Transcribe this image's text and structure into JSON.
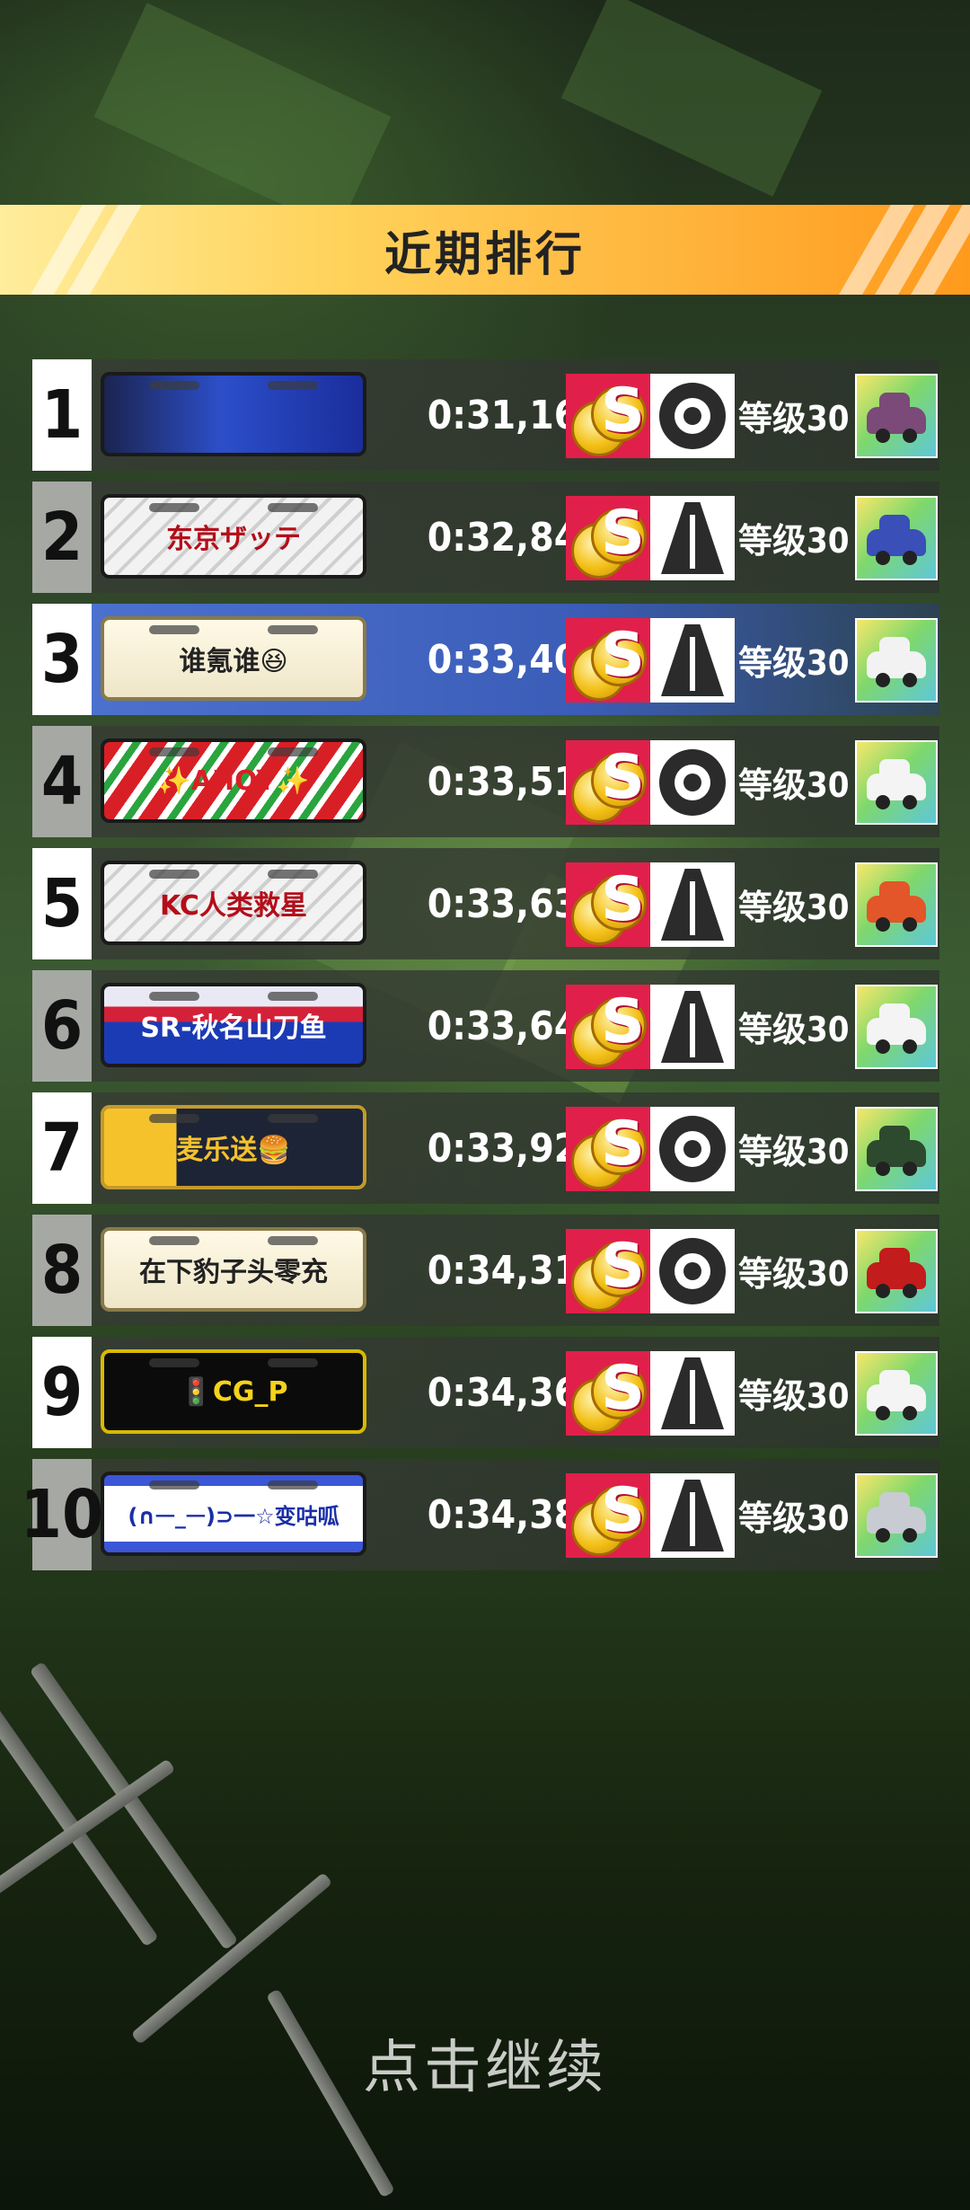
{
  "header": {
    "title": "近期排行"
  },
  "rows": [
    {
      "rank": "1",
      "plate": "",
      "plate_style": "blue-graphic",
      "time": "0:31,16",
      "tyre": "wheel",
      "level": "等级30",
      "car_color": "#7b4a78"
    },
    {
      "rank": "2",
      "plate": "东京ザッテ",
      "plate_style": "green-stripe",
      "time": "0:32,84",
      "tyre": "road",
      "level": "等级30",
      "car_color": "#3a4fb8"
    },
    {
      "rank": "3",
      "plate": "谁氪谁😆",
      "plate_style": "cream",
      "time": "0:33,40",
      "tyre": "road",
      "level": "等级30",
      "car_color": "#f2f2f2"
    },
    {
      "rank": "4",
      "plate": "✨AHOY✨",
      "plate_style": "red-green",
      "time": "0:33,51",
      "tyre": "wheel",
      "level": "等级30",
      "car_color": "#f4f4f4"
    },
    {
      "rank": "5",
      "plate": "KC人类救星",
      "plate_style": "green-stripe",
      "time": "0:33,63",
      "tyre": "road",
      "level": "等级30",
      "car_color": "#e2562a"
    },
    {
      "rank": "6",
      "plate": "SR-秋名山刀鱼",
      "plate_style": "flag-blue",
      "time": "0:33,64",
      "tyre": "road",
      "level": "等级30",
      "car_color": "#f4f4f4"
    },
    {
      "rank": "7",
      "plate": "麦乐送🍔",
      "plate_style": "gold-dark",
      "time": "0:33,92",
      "tyre": "wheel",
      "level": "等级30",
      "car_color": "#2e4a2e"
    },
    {
      "rank": "8",
      "plate": "在下豹子头零充",
      "plate_style": "cream",
      "time": "0:34,31",
      "tyre": "wheel",
      "level": "等级30",
      "car_color": "#c21c1c"
    },
    {
      "rank": "9",
      "plate": "🚦CG_P",
      "plate_style": "black-yellow",
      "time": "0:34,36",
      "tyre": "road",
      "level": "等级30",
      "car_color": "#f4f4f4"
    },
    {
      "rank": "10",
      "plate": "(∩ᅳ_ᅳ)⊃一☆变咕呱",
      "plate_style": "white-blue",
      "time": "0:34,38",
      "tyre": "road",
      "level": "等级30",
      "car_color": "#c8ccd2"
    }
  ],
  "highlight_rank": "3",
  "footer": {
    "continue_label": "点击继续"
  },
  "colors": {
    "header_start": "#ffed9c",
    "header_end": "#ff9a1c",
    "highlight_row": "#4d74d0",
    "coin_badge": "#e0204a"
  }
}
